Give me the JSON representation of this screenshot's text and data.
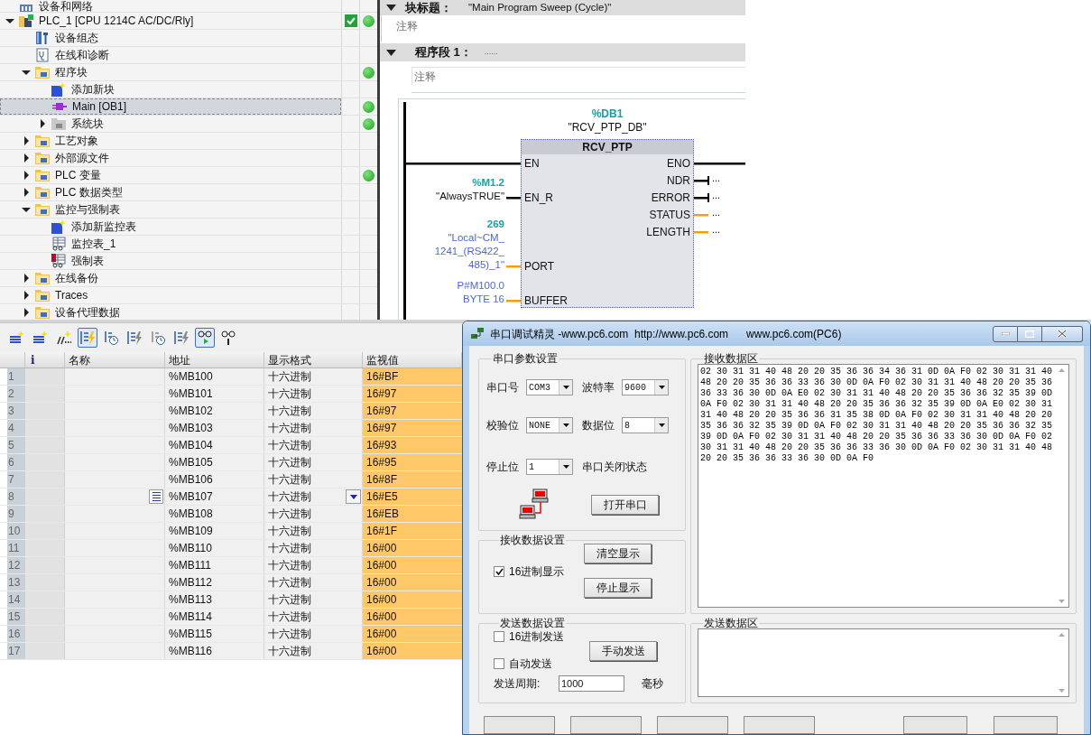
{
  "project_tree": {
    "items": [
      {
        "label": "设备和网络",
        "kind": "network",
        "selected": false,
        "online": false,
        "consistent": false
      },
      {
        "label": "PLC_1 [CPU 1214C AC/DC/Rly]",
        "kind": "cpu",
        "expanded": true,
        "selected": false,
        "online": true,
        "consistent": true,
        "children": [
          {
            "label": "设备组态",
            "kind": "config",
            "selected": false,
            "online": false,
            "consistent": false
          },
          {
            "label": "在线和诊断",
            "kind": "diag",
            "selected": false,
            "online": false,
            "consistent": false
          },
          {
            "label": "程序块",
            "kind": "folder",
            "expanded": true,
            "selected": false,
            "online": true,
            "consistent": false,
            "children": [
              {
                "label": "添加新块",
                "kind": "add",
                "selected": false,
                "online": false,
                "consistent": false
              },
              {
                "label": "Main [OB1]",
                "kind": "ob",
                "selected": true,
                "online": true,
                "consistent": false
              },
              {
                "label": "系统块",
                "kind": "sysfolder",
                "expanded": false,
                "selected": false,
                "online": true,
                "consistent": false
              }
            ]
          },
          {
            "label": "工艺对象",
            "kind": "folder",
            "expanded": false,
            "selected": false,
            "online": false,
            "consistent": false
          },
          {
            "label": "外部源文件",
            "kind": "folder",
            "expanded": false,
            "selected": false,
            "online": false,
            "consistent": false
          },
          {
            "label": "PLC 变量",
            "kind": "folder",
            "expanded": false,
            "selected": false,
            "online": true,
            "consistent": false
          },
          {
            "label": "PLC 数据类型",
            "kind": "folder",
            "expanded": false,
            "selected": false,
            "online": false,
            "consistent": false
          },
          {
            "label": "监控与强制表",
            "kind": "folder",
            "expanded": true,
            "selected": false,
            "online": false,
            "consistent": false,
            "children": [
              {
                "label": "添加新监控表",
                "kind": "add",
                "selected": false,
                "online": false,
                "consistent": false
              },
              {
                "label": "监控表_1",
                "kind": "table",
                "selected": false,
                "online": false,
                "consistent": false
              },
              {
                "label": "强制表",
                "kind": "forcetable",
                "selected": false,
                "online": false,
                "consistent": false
              }
            ]
          },
          {
            "label": "在线备份",
            "kind": "folder",
            "expanded": false,
            "selected": false,
            "online": false,
            "consistent": false
          },
          {
            "label": "Traces",
            "kind": "folder",
            "expanded": false,
            "selected": false,
            "online": false,
            "consistent": false
          },
          {
            "label": "设备代理数据",
            "kind": "folder",
            "expanded": false,
            "selected": false,
            "online": false,
            "consistent": false
          }
        ]
      }
    ]
  },
  "editor": {
    "block_title": {
      "label": "块标题：",
      "value": "\"Main Program Sweep (Cycle)\"",
      "expanded": true
    },
    "block_comment": "注释",
    "network": {
      "label": "程序段 1：",
      "title": "......",
      "expanded": true
    },
    "network_comment": "注释",
    "block": {
      "instance_address": "%DB1",
      "instance_name": "\"RCV_PTP_DB\"",
      "type": "RCV_PTP",
      "inputs": [
        {
          "pin": "EN",
          "kind": "power"
        },
        {
          "pin": "EN_R",
          "kind": "bool",
          "address": "%M1.2",
          "lines": [
            "\"AlwaysTRUE\""
          ]
        },
        {
          "pin": "PORT",
          "kind": "data",
          "address": "269",
          "lines": [
            "\"Local~CM_",
            "1241_(RS422_",
            "485)_1\""
          ]
        },
        {
          "pin": "BUFFER",
          "kind": "data",
          "lines": [
            "P#M100.0",
            "BYTE 16"
          ]
        }
      ],
      "outputs": [
        {
          "pin": "ENO",
          "kind": "power"
        },
        {
          "pin": "NDR",
          "kind": "bool",
          "operand": "..."
        },
        {
          "pin": "ERROR",
          "kind": "bool",
          "operand": "..."
        },
        {
          "pin": "STATUS",
          "kind": "data",
          "operand": "..."
        },
        {
          "pin": "LENGTH",
          "kind": "data",
          "operand": "..."
        }
      ]
    }
  },
  "watch_table": {
    "toolbar": [
      {
        "kind": "insertrow",
        "pressed": false
      },
      {
        "kind": "addrow",
        "pressed": false
      },
      {
        "kind": "multi",
        "pressed": false
      },
      {
        "kind": "monitor",
        "pressed": true
      },
      {
        "kind": "trigger",
        "pressed": false
      },
      {
        "kind": "modify",
        "pressed": false
      },
      {
        "kind": "modifytrigger",
        "pressed": false
      },
      {
        "kind": "enable",
        "pressed": false
      },
      {
        "kind": "watchall",
        "pressed": true
      },
      {
        "kind": "watchonce",
        "pressed": false
      }
    ],
    "columns": [
      "i",
      "名称",
      "地址",
      "显示格式",
      "监视值"
    ],
    "rows": [
      {
        "num": "1",
        "address": "%MB100",
        "format": "十六进制",
        "value": "16#BF",
        "active": false
      },
      {
        "num": "2",
        "address": "%MB101",
        "format": "十六进制",
        "value": "16#97",
        "active": false
      },
      {
        "num": "3",
        "address": "%MB102",
        "format": "十六进制",
        "value": "16#97",
        "active": false
      },
      {
        "num": "4",
        "address": "%MB103",
        "format": "十六进制",
        "value": "16#97",
        "active": false
      },
      {
        "num": "5",
        "address": "%MB104",
        "format": "十六进制",
        "value": "16#93",
        "active": false
      },
      {
        "num": "6",
        "address": "%MB105",
        "format": "十六进制",
        "value": "16#95",
        "active": false
      },
      {
        "num": "7",
        "address": "%MB106",
        "format": "十六进制",
        "value": "16#8F",
        "active": false
      },
      {
        "num": "8",
        "address": "%MB107",
        "format": "十六进制",
        "value": "16#E5",
        "active": true
      },
      {
        "num": "9",
        "address": "%MB108",
        "format": "十六进制",
        "value": "16#EB",
        "active": false
      },
      {
        "num": "10",
        "address": "%MB109",
        "format": "十六进制",
        "value": "16#1F",
        "active": false
      },
      {
        "num": "11",
        "address": "%MB110",
        "format": "十六进制",
        "value": "16#00",
        "active": false
      },
      {
        "num": "12",
        "address": "%MB111",
        "format": "十六进制",
        "value": "16#00",
        "active": false
      },
      {
        "num": "13",
        "address": "%MB112",
        "format": "十六进制",
        "value": "16#00",
        "active": false
      },
      {
        "num": "14",
        "address": "%MB113",
        "format": "十六进制",
        "value": "16#00",
        "active": false
      },
      {
        "num": "15",
        "address": "%MB114",
        "format": "十六进制",
        "value": "16#00",
        "active": false
      },
      {
        "num": "16",
        "address": "%MB115",
        "format": "十六进制",
        "value": "16#00",
        "active": false
      },
      {
        "num": "17",
        "address": "%MB116",
        "format": "十六进制",
        "value": "16#00",
        "active": false
      }
    ]
  },
  "serial_tool": {
    "title": "串口调试精灵 -www.pc6.com  http://www.pc6.com      www.pc6.com(PC6)",
    "port_settings": {
      "title": "串口参数设置",
      "fields": [
        {
          "label": "串口号",
          "value": "COM3"
        },
        {
          "label": "波特率",
          "value": "9600"
        },
        {
          "label": "校验位",
          "value": "NONE"
        },
        {
          "label": "数据位",
          "value": "8"
        },
        {
          "label": "停止位",
          "value": "1"
        }
      ],
      "status": "串口关闭状态",
      "open_button": "打开串口"
    },
    "receive_settings": {
      "title": "接收数据设置",
      "hex_display": {
        "label": "16进制显示",
        "checked": true
      },
      "buttons": [
        "清空显示",
        "停止显示"
      ]
    },
    "receive_area": {
      "title": "接收数据区",
      "lines": [
        "02 30 31 31 40 48 20 20 35 36 36 34 36 31 0D 0A F0 02 30 31 31 40",
        "48 20 20 35 36 36 33 36 30 0D 0A F0 02 30 31 31 40 48 20 20 35 36",
        "36 33 36 30 0D 0A E0 02 30 31 31 40 48 20 20 35 36 36 32 35 39 0D",
        "0A F0 02 30 31 31 40 48 20 20 35 36 36 32 35 39 0D 0A E0 02 30 31",
        "31 40 48 20 20 35 36 36 31 35 38 0D 0A F0 02 30 31 31 40 48 20 20",
        "35 36 36 32 35 39 0D 0A F0 02 30 31 31 40 48 20 20 35 36 36 32 35",
        "39 0D 0A F0 02 30 31 31 40 48 20 20 35 36 36 33 36 30 0D 0A F0 02",
        "30 31 31 40 48 20 20 35 36 36 33 36 30 0D 0A F0 02 30 31 31 40 48",
        "20 20 35 36 36 33 36 30 0D 0A F0"
      ]
    },
    "send_settings": {
      "title": "发送数据设置",
      "checkboxes": [
        {
          "label": "16进制发送",
          "checked": false
        },
        {
          "label": "自动发送",
          "checked": false
        }
      ],
      "send_button": "手动发送",
      "period_label": "发送周期:",
      "period_value": "1000",
      "unit": "毫秒"
    },
    "send_area": {
      "title": "发送数据区"
    }
  }
}
